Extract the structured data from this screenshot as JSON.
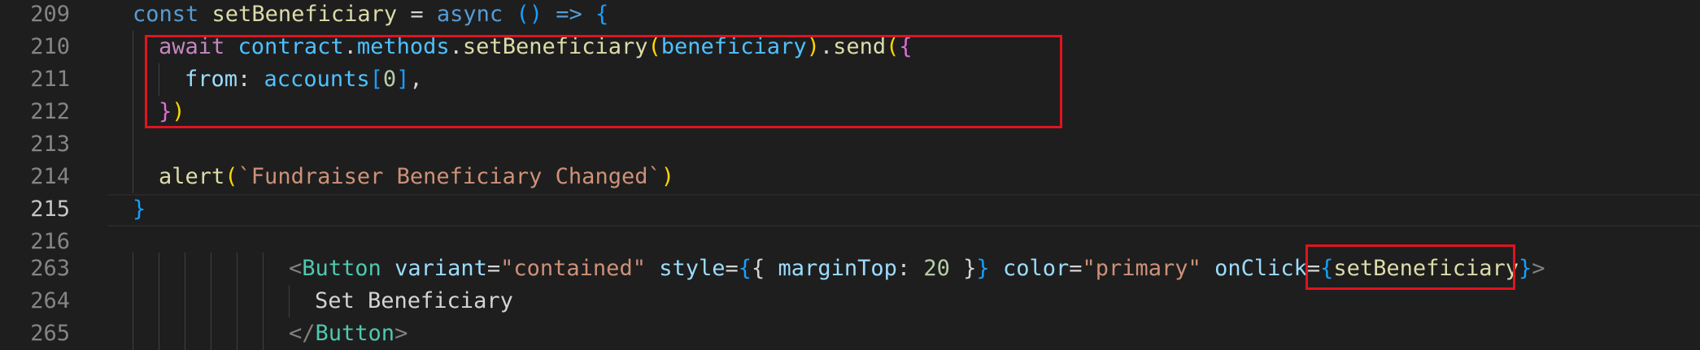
{
  "editor": {
    "lines": [
      {
        "number": "209",
        "tokens": [
          {
            "t": "const",
            "c": "k-store"
          },
          {
            "t": " ",
            "c": "txt"
          },
          {
            "t": "setBeneficiary",
            "c": "fn"
          },
          {
            "t": " = ",
            "c": "txt"
          },
          {
            "t": "async",
            "c": "k-store"
          },
          {
            "t": " ",
            "c": "txt"
          },
          {
            "t": "()",
            "c": "b3"
          },
          {
            "t": " ",
            "c": "txt"
          },
          {
            "t": "=>",
            "c": "k-store"
          },
          {
            "t": " ",
            "c": "txt"
          },
          {
            "t": "{",
            "c": "b3"
          }
        ]
      },
      {
        "number": "210",
        "tokens": [
          {
            "t": "await",
            "c": "k-ctrl"
          },
          {
            "t": " ",
            "c": "txt"
          },
          {
            "t": "contract",
            "c": "var"
          },
          {
            "t": ".",
            "c": "txt"
          },
          {
            "t": "methods",
            "c": "var"
          },
          {
            "t": ".",
            "c": "txt"
          },
          {
            "t": "setBeneficiary",
            "c": "fn"
          },
          {
            "t": "(",
            "c": "b1"
          },
          {
            "t": "beneficiary",
            "c": "var"
          },
          {
            "t": ")",
            "c": "b1"
          },
          {
            "t": ".",
            "c": "txt"
          },
          {
            "t": "send",
            "c": "fn"
          },
          {
            "t": "(",
            "c": "b1"
          },
          {
            "t": "{",
            "c": "b2"
          }
        ]
      },
      {
        "number": "211",
        "tokens": [
          {
            "t": "from",
            "c": "prop"
          },
          {
            "t": ": ",
            "c": "txt"
          },
          {
            "t": "accounts",
            "c": "var"
          },
          {
            "t": "[",
            "c": "b3"
          },
          {
            "t": "0",
            "c": "num"
          },
          {
            "t": "]",
            "c": "b3"
          },
          {
            "t": ",",
            "c": "txt"
          }
        ]
      },
      {
        "number": "212",
        "tokens": [
          {
            "t": "}",
            "c": "b2"
          },
          {
            "t": ")",
            "c": "b1"
          }
        ]
      },
      {
        "number": "213",
        "tokens": []
      },
      {
        "number": "214",
        "tokens": [
          {
            "t": "alert",
            "c": "fn"
          },
          {
            "t": "(",
            "c": "b1"
          },
          {
            "t": "`Fundraiser Beneficiary Changed`",
            "c": "str"
          },
          {
            "t": ")",
            "c": "b1"
          }
        ]
      },
      {
        "number": "215",
        "tokens": [
          {
            "t": "}",
            "c": "b3"
          }
        ]
      },
      {
        "number": "216",
        "tokens": []
      },
      {
        "number": "263",
        "tokens": [
          {
            "t": "<",
            "c": "tagp"
          },
          {
            "t": "Button",
            "c": "tag"
          },
          {
            "t": " ",
            "c": "txt"
          },
          {
            "t": "variant",
            "c": "prop"
          },
          {
            "t": "=",
            "c": "txt"
          },
          {
            "t": "\"contained\"",
            "c": "str"
          },
          {
            "t": " ",
            "c": "txt"
          },
          {
            "t": "style",
            "c": "prop"
          },
          {
            "t": "=",
            "c": "txt"
          },
          {
            "t": "{",
            "c": "b3"
          },
          {
            "t": "{ ",
            "c": "txt"
          },
          {
            "t": "marginTop",
            "c": "prop"
          },
          {
            "t": ": ",
            "c": "txt"
          },
          {
            "t": "20",
            "c": "num"
          },
          {
            "t": " }",
            "c": "txt"
          },
          {
            "t": "}",
            "c": "b3"
          },
          {
            "t": " ",
            "c": "txt"
          },
          {
            "t": "color",
            "c": "prop"
          },
          {
            "t": "=",
            "c": "txt"
          },
          {
            "t": "\"primary\"",
            "c": "str"
          },
          {
            "t": " ",
            "c": "txt"
          },
          {
            "t": "onClick",
            "c": "prop"
          },
          {
            "t": "=",
            "c": "txt"
          },
          {
            "t": "{",
            "c": "b3"
          },
          {
            "t": "setBeneficiary",
            "c": "fn"
          },
          {
            "t": "}",
            "c": "b3"
          },
          {
            "t": ">",
            "c": "tagp"
          }
        ]
      },
      {
        "number": "264",
        "tokens": [
          {
            "t": "Set Beneficiary",
            "c": "txt"
          }
        ]
      },
      {
        "number": "265",
        "tokens": [
          {
            "t": "</",
            "c": "tagp"
          },
          {
            "t": "Button",
            "c": "tag"
          },
          {
            "t": ">",
            "c": "tagp"
          }
        ]
      }
    ]
  },
  "colors": {
    "background": "#1e1e1e",
    "highlight_box": "#e0141e"
  }
}
